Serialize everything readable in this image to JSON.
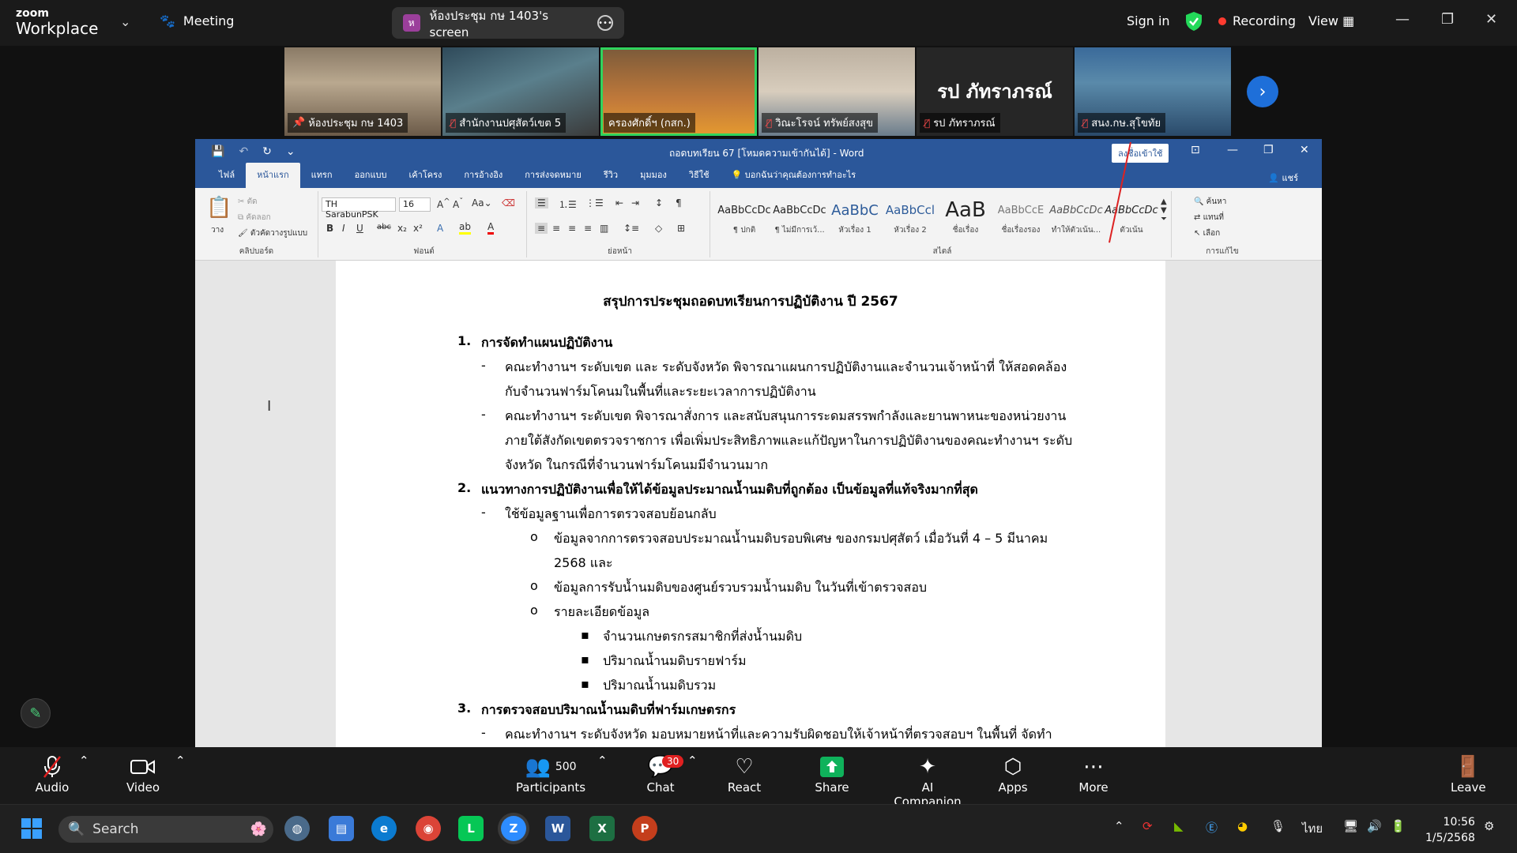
{
  "zoom": {
    "brand_small": "zoom",
    "brand_large": "Workplace",
    "meeting_label": "Meeting",
    "screen_share_title": "ห้องประชุม กษ 1403's screen",
    "screen_avatar_letter": "ห",
    "sign_in": "Sign in",
    "recording": "Recording",
    "view": "View"
  },
  "participants": [
    {
      "name": "ห้องประชุม กษ 1403",
      "pinned": true
    },
    {
      "name": "สำนักงานปศุสัตว์เขต 5",
      "muted": true
    },
    {
      "name": "ครองศักดิ์ฯ (กสก.)",
      "active": true
    },
    {
      "name": "วิณะโรจน์ ทรัพย์สงสุข",
      "muted": true
    },
    {
      "name": "รป ภัทราภรณ์",
      "muted": true,
      "display_name": "รป ภัทราภรณ์"
    },
    {
      "name": "สนง.กษ.สุโขทัย",
      "muted": true
    }
  ],
  "word": {
    "doc_title": "ถอดบทเรียน 67 [โหมดความเข้ากันได้] - Word",
    "signin_btn": "ลงชื่อเข้าใช้",
    "tabs": [
      "ไฟล์",
      "หน้าแรก",
      "แทรก",
      "ออกแบบ",
      "เค้าโครง",
      "การอ้างอิง",
      "การส่งจดหมาย",
      "รีวิว",
      "มุมมอง",
      "วิธีใช้"
    ],
    "tell_me": "บอกฉันว่าคุณต้องการทำอะไร",
    "share": "แชร์",
    "font_name": "TH SarabunPSK",
    "font_size": "16",
    "groups": {
      "clipboard": "คลิปบอร์ด",
      "font": "ฟอนต์",
      "paragraph": "ย่อหน้า",
      "styles": "สไตล์",
      "editing": "การแก้ไข"
    },
    "clipboard": {
      "paste": "วาง",
      "cut": "ตัด",
      "copy": "คัดลอก",
      "painter": "ตัวคัดวางรูปแบบ"
    },
    "editing": {
      "find": "ค้นหา",
      "replace": "แทนที่",
      "select": "เลือก"
    },
    "styles": [
      {
        "preview": "AaBbCcDc",
        "name": "¶ ปกติ"
      },
      {
        "preview": "AaBbCcDc",
        "name": "¶ ไม่มีการเว้...",
        "dummy": ""
      },
      {
        "preview": "AaBbC",
        "name": "หัวเรื่อง 1"
      },
      {
        "preview": "AaBbCcl",
        "name": "หัวเรื่อง 2"
      },
      {
        "preview": "AaB",
        "name": "ชื่อเรื่อง"
      },
      {
        "preview": "AaBbCcE",
        "name": "ชื่อเรื่องรอง"
      },
      {
        "preview": "AaBbCcDc",
        "name": "ทำให้ตัวเน้น..."
      },
      {
        "preview": "AaBbCcDc",
        "name": "ตัวเน้น"
      }
    ]
  },
  "document": {
    "title": "สรุปการประชุมถอดบทเรียนการปฏิบัติงาน  ปี 2567",
    "s1_num": "1.",
    "s1": "การจัดทำแผนปฏิบัติงาน",
    "s1_b1_l1": "คณะทำงานฯ ระดับเขต และ ระดับจังหวัด พิจารณาแผนการปฏิบัติงานและจำนวนเจ้าหน้าที่ ให้สอดคล้อง",
    "s1_b1_l2": "กับจำนวนฟาร์มโคนมในพื้นที่และระยะเวลาการปฏิบัติงาน",
    "s1_b2_l1": "คณะทำงานฯ ระดับเขต พิจารณาสั่งการ และสนับสนุนการระดมสรรพกำลังและยานพาหนะของหน่วยงาน",
    "s1_b2_l2": "ภายใต้สังกัดเขตตรวจราชการ เพื่อเพิ่มประสิทธิภาพและแก้ปัญหาในการปฏิบัติงานของคณะทำงานฯ ระดับ",
    "s1_b2_l3": "จังหวัด ในกรณีที่จำนวนฟาร์มโคนมมีจำนวนมาก",
    "s2_num": "2.",
    "s2": "แนวทางการปฏิบัติงานเพื่อให้ได้ข้อมูลประมาณน้ำนมดิบที่ถูกต้อง เป็นข้อมูลที่แท้จริงมากที่สุด",
    "s2_b1": "ใช้ข้อมูลฐานเพื่อการตรวจสอบย้อนกลับ",
    "s2_c1_l1": "ข้อมูลจากการตรวจสอบประมาณน้ำนมดิบรอบพิเศษ  ของกรมปศุสัตว์ เมื่อวันที่ 4 – 5 มีนาคม",
    "s2_c1_l2": "2568 และ",
    "s2_c2": "ข้อมูลการรับน้ำนมดิบของศูนย์รวบรวมน้ำนมดิบ ในวันที่เข้าตรวจสอบ",
    "s2_c3": "รายละเอียดข้อมูล",
    "s2_d1": "จำนวนเกษตรกรสมาชิกที่ส่งน้ำนมดิบ",
    "s2_d2": "ปริมาณน้ำนมดิบรายฟาร์ม",
    "s2_d3": "ปริมาณน้ำนมดิบรวม",
    "s3_num": "3.",
    "s3": "การตรวจสอบปริมาณน้ำนมดิบที่ฟาร์มเกษตรกร",
    "s3_b1": "คณะทำงานฯ ระดับจังหวัด มอบหมายหน้าที่และความรับผิดชอบให้เจ้าหน้าที่ตรวจสอบฯ ในพื้นที่ จัดทำ",
    "dash": "-",
    "circle": "o",
    "square": "▪"
  },
  "controls": {
    "audio": "Audio",
    "video": "Video",
    "participants": "Participants",
    "participant_count": "500",
    "chat": "Chat",
    "chat_badge": "30",
    "react": "React",
    "share": "Share",
    "ai": "AI Companion",
    "apps": "Apps",
    "more": "More",
    "leave": "Leave"
  },
  "taskbar": {
    "search": "Search",
    "lang": "ไทย",
    "time": "10:56",
    "date": "1/5/2568"
  },
  "colors": {
    "word_blue": "#2b579a",
    "zoom_green": "#23d959",
    "record_red": "#ff3b30",
    "share_green": "#0fb25b"
  }
}
